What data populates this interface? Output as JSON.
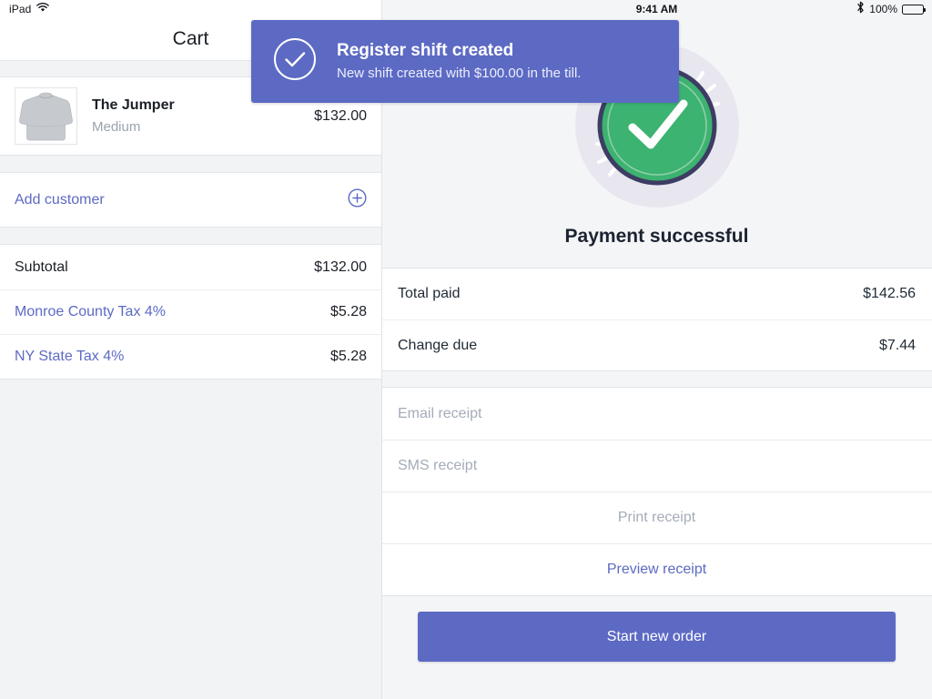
{
  "colors": {
    "brand_purple": "#5c6ac4",
    "success_green": "#3cb371",
    "panel_grey": "#f4f5f7",
    "text_dark": "#1b1f26",
    "text_muted": "#a4acb9"
  },
  "left_panel": {
    "status_bar": {
      "device": "iPad",
      "wifi_icon": "wifi-icon"
    },
    "nav": {
      "title": "Cart"
    },
    "cart_items": [
      {
        "thumbnail_icon": "sweatshirt-thumbnail",
        "name": "The Jumper",
        "variant": "Medium",
        "price": "$132.00"
      }
    ],
    "add_customer": {
      "label": "Add customer",
      "icon": "plus-circle-icon"
    },
    "totals": [
      {
        "label": "Subtotal",
        "value": "$132.00",
        "style": "plain"
      },
      {
        "label": "Monroe County Tax 4%",
        "value": "$5.28",
        "style": "tax"
      },
      {
        "label": "NY State Tax 4%",
        "value": "$5.28",
        "style": "tax"
      }
    ]
  },
  "right_panel": {
    "status_bar": {
      "time": "9:41 AM",
      "bluetooth_icon": "bluetooth-icon",
      "battery_percent": "100%",
      "battery_icon": "battery-full-icon"
    },
    "hero": {
      "icon": "success-check-circle-icon",
      "title": "Payment successful"
    },
    "payment_rows": [
      {
        "label": "Total paid",
        "value": "$142.56"
      },
      {
        "label": "Change due",
        "value": "$7.44"
      }
    ],
    "receipt_options": [
      {
        "kind": "input",
        "name": "email-receipt",
        "placeholder": "Email receipt",
        "value": ""
      },
      {
        "kind": "input",
        "name": "sms-receipt",
        "placeholder": "SMS receipt",
        "value": ""
      },
      {
        "kind": "action",
        "name": "print-receipt",
        "label": "Print receipt",
        "state": "disabled"
      },
      {
        "kind": "action",
        "name": "preview-receipt",
        "label": "Preview receipt",
        "state": "link"
      }
    ],
    "primary_action": {
      "label": "Start new order"
    }
  },
  "toast": {
    "icon": "check-circle-icon",
    "title": "Register shift created",
    "subtitle": "New shift created with $100.00 in the till."
  }
}
